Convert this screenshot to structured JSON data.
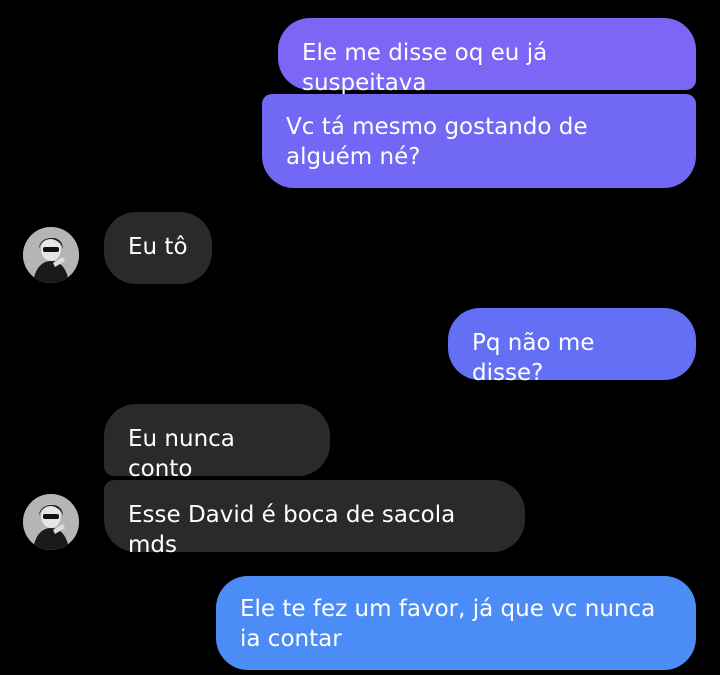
{
  "conversation": {
    "messages": [
      {
        "sender": "me",
        "text": "Ele me disse oq eu já suspeitava"
      },
      {
        "sender": "me",
        "text": "Vc tá mesmo gostando de alguém né?"
      },
      {
        "sender": "contact",
        "text": "Eu tô"
      },
      {
        "sender": "me",
        "text": "Pq não me disse?"
      },
      {
        "sender": "contact",
        "text": "Eu nunca conto"
      },
      {
        "sender": "contact",
        "text": "Esse David é boca de sacola mds"
      },
      {
        "sender": "me",
        "text": "Ele te fez um favor, já que vc nunca ia contar"
      }
    ]
  },
  "colors": {
    "background": "#000000",
    "incoming_bubble": "#2a2a2a",
    "outgoing_gradient_top": "#7b66f5",
    "outgoing_gradient_bottom": "#4c8cf7"
  },
  "icons": {
    "contact_avatar": "contact-avatar-photo"
  }
}
